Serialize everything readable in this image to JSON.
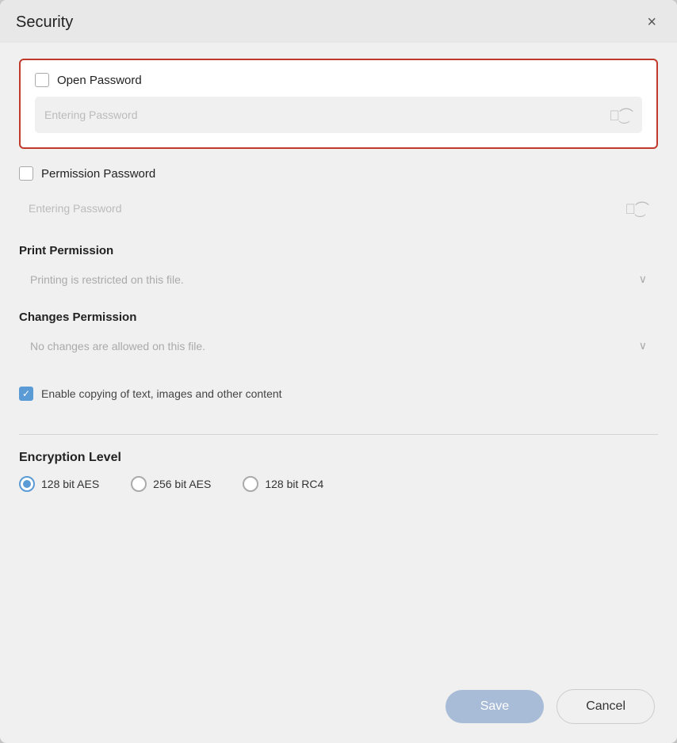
{
  "dialog": {
    "title": "Security",
    "close_label": "×"
  },
  "open_password": {
    "label": "Open Password",
    "placeholder": "Entering Password",
    "checked": false
  },
  "permission_password": {
    "label": "Permission Password",
    "placeholder": "Entering Password",
    "checked": false
  },
  "print_permission": {
    "label": "Print Permission",
    "dropdown_text": "Printing is restricted on this file.",
    "dropdown_arrow": "⌄"
  },
  "changes_permission": {
    "label": "Changes Permission",
    "dropdown_text": "No changes are allowed on this file.",
    "dropdown_arrow": "⌄"
  },
  "copy_checkbox": {
    "label": "Enable copying of text, images and other content",
    "checked": true
  },
  "encryption": {
    "title": "Encryption Level",
    "options": [
      {
        "label": "128 bit AES",
        "selected": true
      },
      {
        "label": "256 bit AES",
        "selected": false
      },
      {
        "label": "128 bit RC4",
        "selected": false
      }
    ]
  },
  "footer": {
    "save_label": "Save",
    "cancel_label": "Cancel"
  },
  "icons": {
    "eye_closed": "⌒͜⌒",
    "chevron_down": "∨"
  }
}
